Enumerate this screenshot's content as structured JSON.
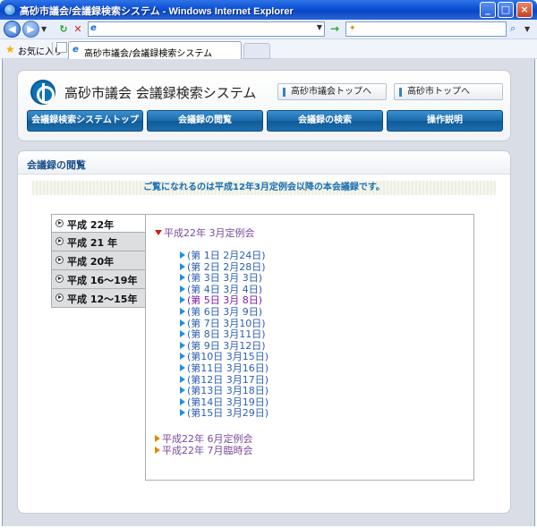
{
  "window": {
    "title": "高砂市議会/会議録検索システム - Windows Internet Explorer",
    "url_value": "",
    "search_value": "",
    "favorites_label": "お気に入り",
    "tab_label": "高砂市議会/会議録検索システム",
    "buttons": {
      "minimize": "_",
      "maximize": "□",
      "close": "×"
    }
  },
  "header": {
    "site_title": "高砂市議会  会議録検索システム",
    "top_links": [
      "高砂市議会トップへ",
      "高砂市トップへ"
    ],
    "nav_tabs": [
      "会議録検索システムトップ",
      "会議録の閲覧",
      "会議録の検索",
      "操作説明"
    ]
  },
  "content": {
    "heading": "会議録の閲覧",
    "notice": "ご覧になれるのは平成12年3月定例会以降の本会議録です。",
    "eras": [
      "平成 22年",
      "平成 21 年",
      "平成 20年",
      "平成 16～19年",
      "平成 12～15年"
    ],
    "open_session": "平成22年 3月定例会",
    "days": [
      "(第 1日  2月24日)",
      "(第 2日  2月28日)",
      "(第 3日  3月  3日)",
      "(第 4日  3月  4日)",
      "(第 5日  3月  8日)",
      "(第 6日  3月  9日)",
      "(第 7日  3月10日)",
      "(第 8日  3月11日)",
      "(第 9日  3月12日)",
      "(第10日  3月15日)",
      "(第11日  3月16日)",
      "(第12日  3月17日)",
      "(第13日  3月18日)",
      "(第14日  3月19日)",
      "(第15日  3月29日)"
    ],
    "visited_day_index": 4,
    "other_sessions": [
      "平成22年 6月定例会",
      "平成22年 7月臨時会"
    ]
  },
  "colors": {
    "accent": "#1a6aaa",
    "open_marker": "#d41b1b",
    "closed_marker": "#e08a00",
    "day_marker": "#1e90e0"
  }
}
